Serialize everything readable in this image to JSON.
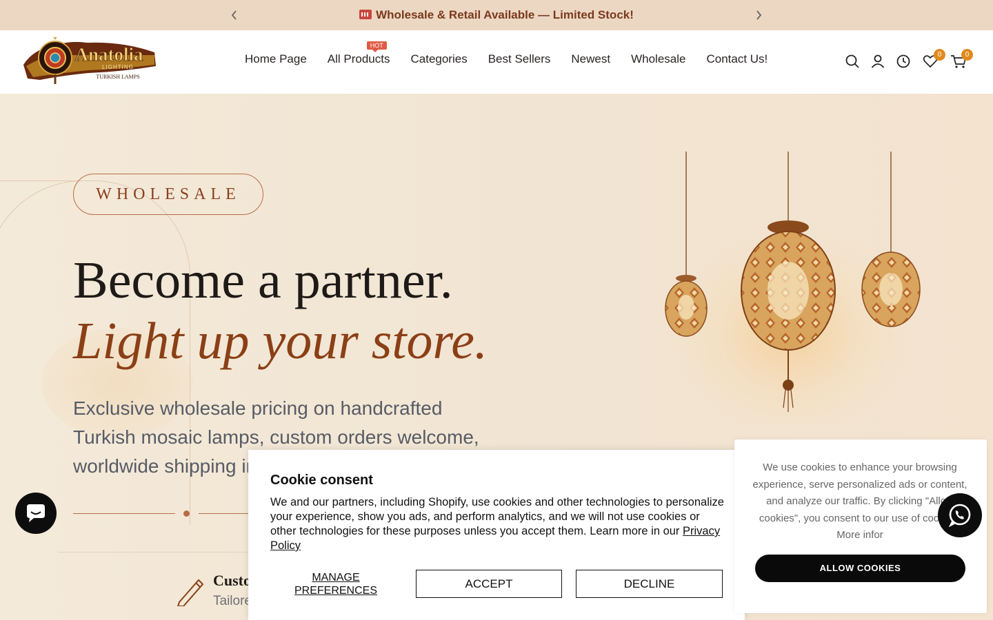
{
  "announcement": {
    "message": "Wholesale & Retail Available — Limited Stock!",
    "prev_icon": "chevron-left-icon",
    "next_icon": "chevron-right-icon"
  },
  "header": {
    "logo": {
      "brand": "Anatolia",
      "line2": "LIGHTING",
      "line3": "TURKISH LAMPS"
    },
    "nav": [
      {
        "label": "Home Page"
      },
      {
        "label": "All Products",
        "badge": "HOT"
      },
      {
        "label": "Categories"
      },
      {
        "label": "Best Sellers"
      },
      {
        "label": "Newest"
      },
      {
        "label": "Wholesale"
      },
      {
        "label": "Contact Us!"
      }
    ],
    "icons": {
      "search": "search-icon",
      "account": "user-icon",
      "recent": "clock-icon",
      "wishlist": "heart-icon",
      "cart": "cart-icon"
    },
    "wishlist_count": "0",
    "cart_count": "0",
    "accent": "#e08a1e"
  },
  "hero": {
    "tag": "WHOLESALE",
    "headline": "Become a partner.",
    "headline_italic": "Light up your store.",
    "subtext": "Exclusive wholesale pricing on handcrafted Turkish mosaic lamps, custom orders welcome, worldwide shipping in",
    "feature": {
      "title": "Custo",
      "desc": "Tailore"
    },
    "brand_color": "#8b3f16"
  },
  "cookie_banner": {
    "title": "Cookie consent",
    "text": "We and our partners, including Shopify, use cookies and other technologies to personalize your experience, show you ads, and perform analytics, and we will not use cookies or other technologies for these purposes unless you accept them. Learn more in our ",
    "link": "Privacy Policy",
    "manage_label": "MANAGE PREFERENCES",
    "accept_label": "ACCEPT",
    "decline_label": "DECLINE"
  },
  "cookie_popup": {
    "text": "We use cookies to enhance your browsing experience, serve personalized ads or content, and analyze our traffic. By clicking \"Allow cookies\", you consent to our use of cookies. More infor",
    "allow_label": "ALLOW COOKIES"
  },
  "floating": {
    "chat_icon": "chat-bubble-icon",
    "whatsapp_icon": "whatsapp-icon"
  }
}
